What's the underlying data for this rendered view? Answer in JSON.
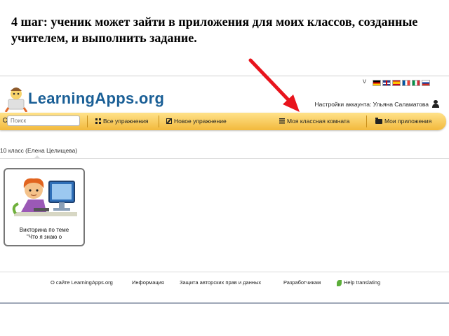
{
  "slide": {
    "title": "4 шаг: ученик может зайти в приложения для моих классов, созданные учителем, и выполнить задание."
  },
  "site": {
    "logo_text": "LearningApps.org",
    "lang_chevron": "v",
    "account_text": "Настройки аккаунта: Ульяна Саламатова"
  },
  "toolbar": {
    "search_placeholder": "Поиск",
    "all_exercises": "Все упражнения",
    "new_exercise": "Новое упражнение",
    "my_classroom": "Моя классная комната",
    "my_apps": "Мои приложения"
  },
  "classroom": {
    "class_name": "10 класс (Елена Целищева)",
    "apps": [
      {
        "label": "Викторина по теме\n\"Что я знаю о"
      }
    ]
  },
  "footer": {
    "about": "О сайте LearningApps.org",
    "info": "Информация",
    "privacy": "Защита авторских прав и данных",
    "developers": "Разработчикам",
    "help": "Help translating"
  },
  "colors": {
    "toolbar_gradient_top": "#ffe28a",
    "toolbar_gradient_bottom": "#f2b93c",
    "logo_blue": "#1a5f96",
    "arrow_red": "#e8141c"
  }
}
